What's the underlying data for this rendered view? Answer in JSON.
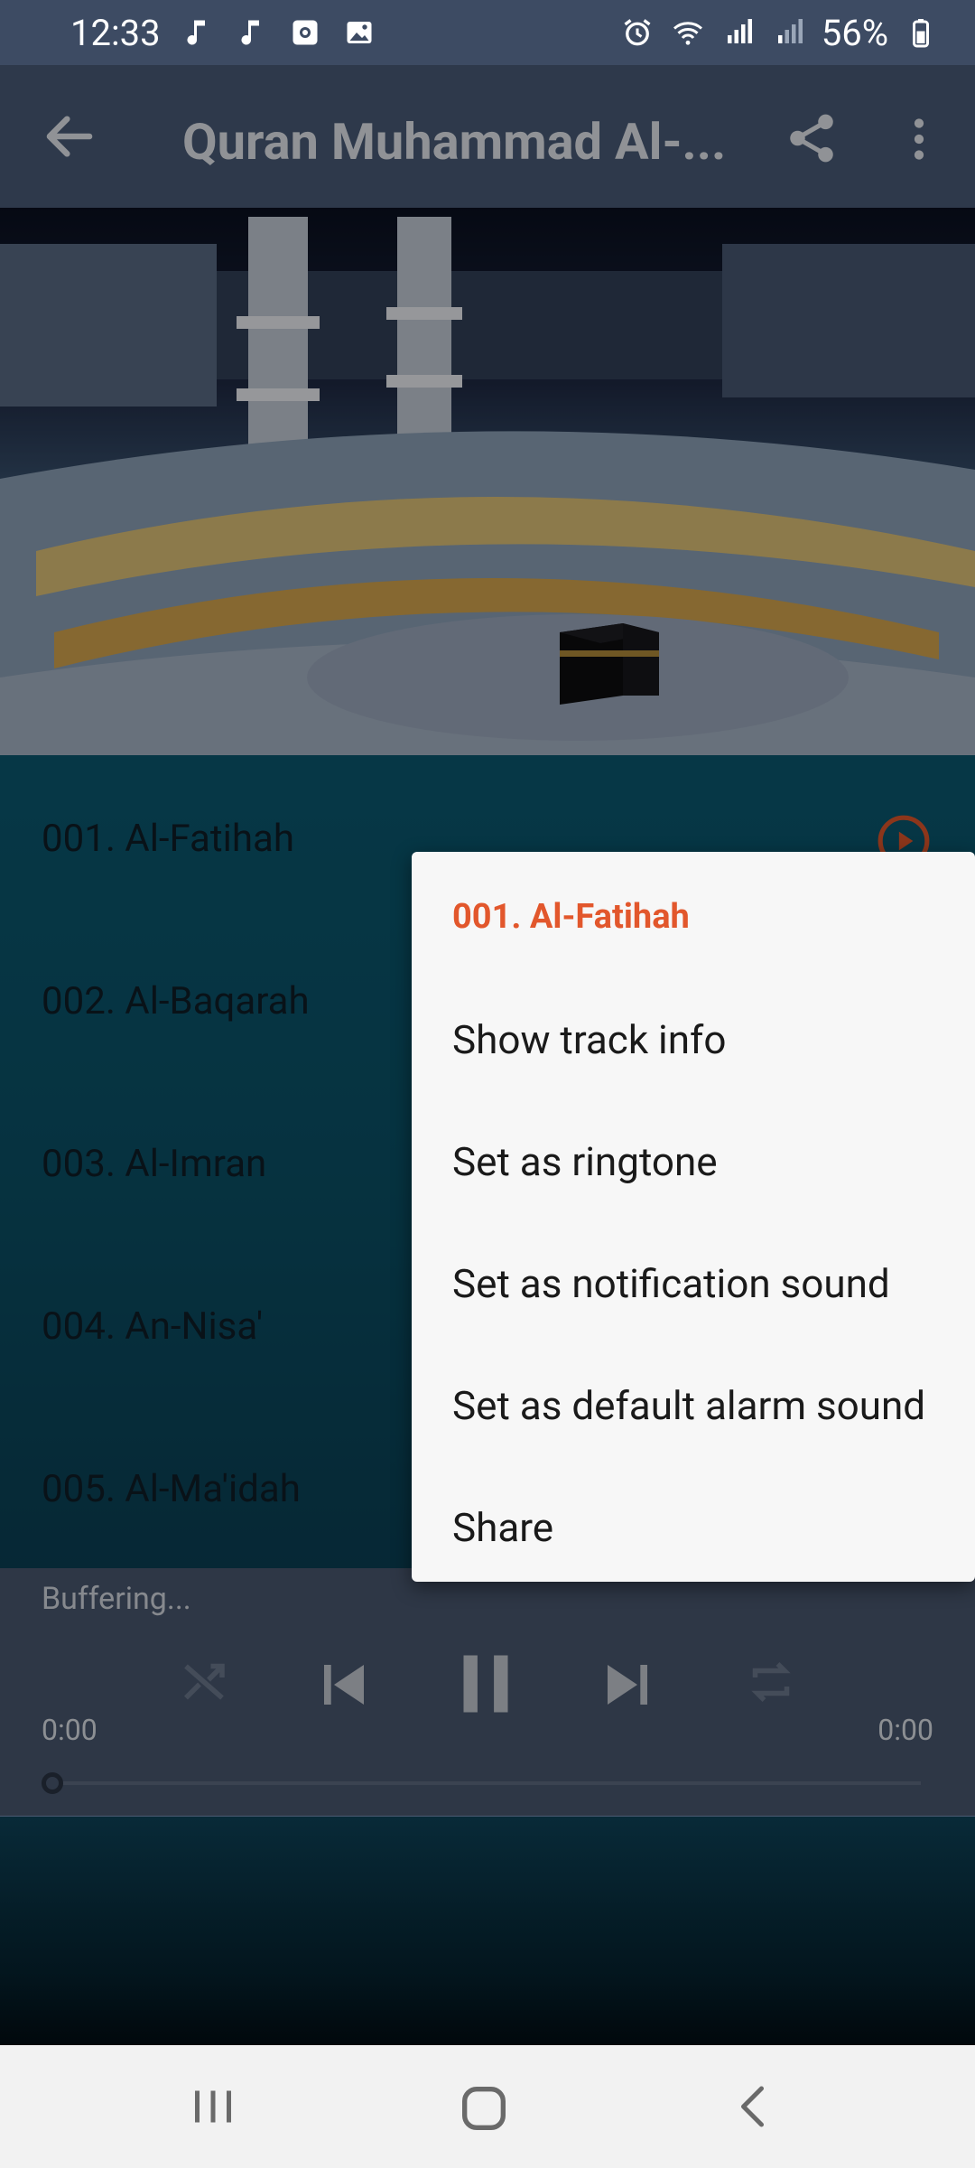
{
  "status_bar": {
    "time": "12:33",
    "battery": "56%",
    "icons_left": [
      "music-note-icon",
      "music-note-icon",
      "camera-app-icon",
      "gallery-icon"
    ],
    "icons_right": [
      "alarm-icon",
      "wifi-icon",
      "signal-icon",
      "signal-icon",
      "battery-icon"
    ]
  },
  "app_bar": {
    "title": "Quran Muhammad Al-...",
    "back_icon": "arrow-back-icon",
    "share_icon": "share-icon",
    "more_icon": "more-vert-icon"
  },
  "tracks": [
    {
      "label": "001. Al-Fatihah"
    },
    {
      "label": "002. Al-Baqarah"
    },
    {
      "label": "003. Al-Imran"
    },
    {
      "label": "004. An-Nisa'"
    },
    {
      "label": "005. Al-Ma'idah"
    }
  ],
  "player": {
    "status": "Buffering...",
    "time_elapsed": "0:00",
    "time_total": "0:00",
    "progress": 0,
    "controls": [
      "shuffle-icon",
      "skip-previous-icon",
      "pause-icon",
      "skip-next-icon",
      "repeat-icon"
    ]
  },
  "menu": {
    "header": "001. Al-Fatihah",
    "items": [
      {
        "label": "Show track info"
      },
      {
        "label": "Set as ringtone"
      },
      {
        "label": "Set as notification sound"
      },
      {
        "label": "Set as default alarm sound"
      },
      {
        "label": "Share"
      }
    ]
  },
  "colors": {
    "accent": "#e2572c",
    "app_bar": "#4b5d79",
    "list_background": "#0a5a72",
    "menu_background": "#f7f7f7"
  }
}
